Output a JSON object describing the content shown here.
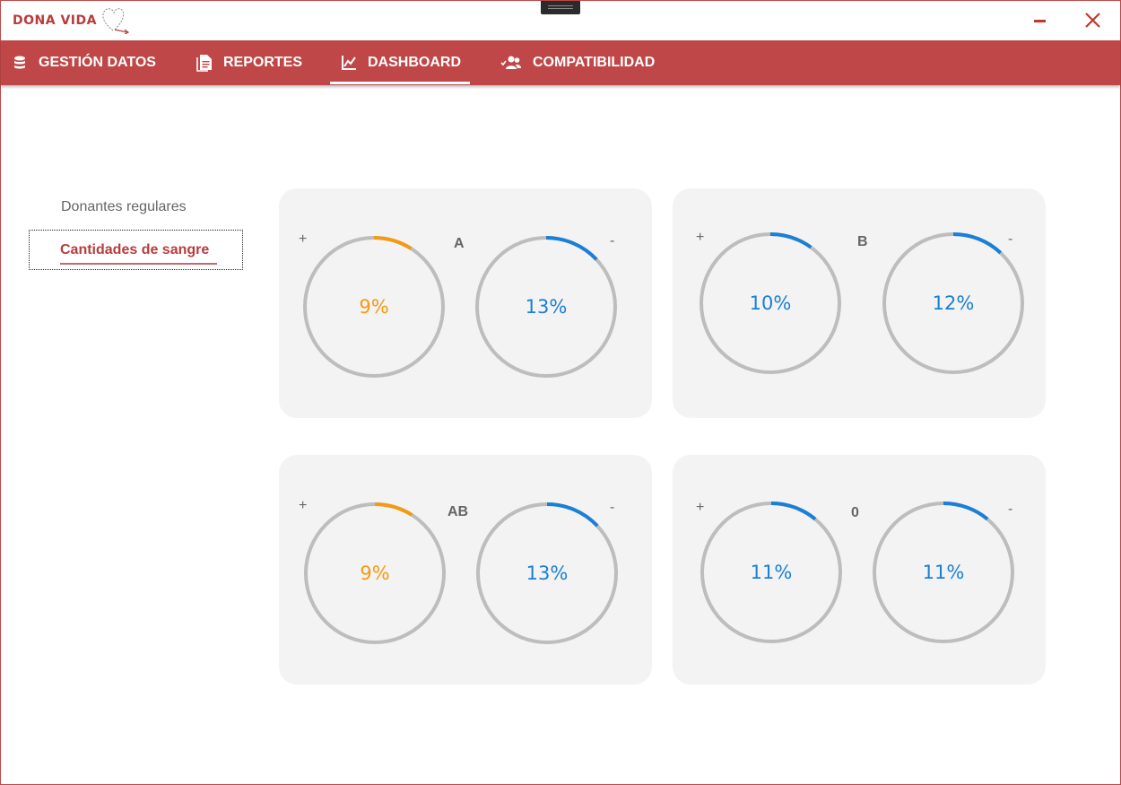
{
  "app": {
    "logo_text": "DONA VIDA"
  },
  "nav": {
    "items": [
      {
        "label": "GESTIÓN DATOS",
        "icon": "database-icon"
      },
      {
        "label": "REPORTES",
        "icon": "document-icon"
      },
      {
        "label": "DASHBOARD",
        "icon": "chart-icon"
      },
      {
        "label": "COMPATIBILIDAD",
        "icon": "users-icon"
      }
    ],
    "active": "DASHBOARD"
  },
  "sidebar": {
    "items": [
      {
        "label": "Donantes regulares"
      },
      {
        "label": "Cantidades de sangre"
      }
    ],
    "selected": "Cantidades de sangre"
  },
  "colors": {
    "brand": "#bf4747",
    "positive_arc": "#f39a12",
    "negative_arc": "#1a7fd6",
    "blue_text": "#1a7fd6",
    "track": "#bdbdbd"
  },
  "cards": [
    {
      "group": "A",
      "plus_sign": "+",
      "minus_sign": "-",
      "positive": {
        "value": 9,
        "label": "9%",
        "color": "#f39a12"
      },
      "negative": {
        "value": 13,
        "label": "13%",
        "color": "#1a7fd6"
      }
    },
    {
      "group": "B",
      "plus_sign": "+",
      "minus_sign": "-",
      "positive": {
        "value": 10,
        "label": "10%",
        "color": "#1a7fd6"
      },
      "negative": {
        "value": 12,
        "label": "12%",
        "color": "#1a7fd6"
      }
    },
    {
      "group": "AB",
      "plus_sign": "+",
      "minus_sign": "-",
      "positive": {
        "value": 9,
        "label": "9%",
        "color": "#f39a12"
      },
      "negative": {
        "value": 13,
        "label": "13%",
        "color": "#1a7fd6"
      }
    },
    {
      "group": "0",
      "plus_sign": "+",
      "minus_sign": "-",
      "positive": {
        "value": 11,
        "label": "11%",
        "color": "#1a7fd6"
      },
      "negative": {
        "value": 11,
        "label": "11%",
        "color": "#1a7fd6"
      }
    }
  ]
}
